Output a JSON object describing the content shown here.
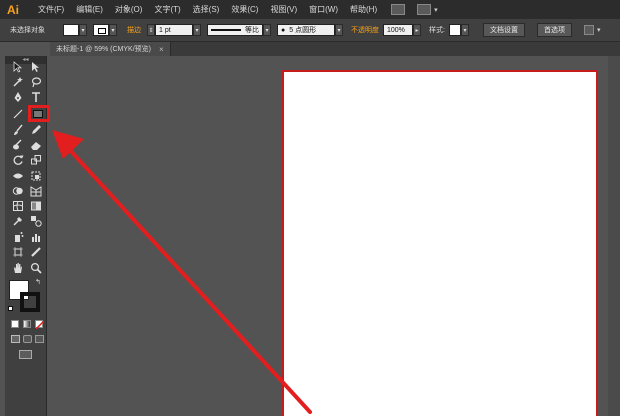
{
  "app": {
    "logo": "Ai"
  },
  "menubar": {
    "items": [
      "文件(F)",
      "编辑(E)",
      "对象(O)",
      "文字(T)",
      "选择(S)",
      "效果(C)",
      "视图(V)",
      "窗口(W)",
      "帮助(H)"
    ],
    "dd_glyph": "▾"
  },
  "controlbar": {
    "selection_label": "未选择对象",
    "stroke_label": "描边",
    "stroke_weight": "1 pt",
    "profile_label": "等比",
    "brush_label": "5 点圆形",
    "opacity_label": "不透明度",
    "opacity_value": "100%",
    "style_label": "样式:",
    "doc_setup": "文档设置",
    "preferences": "首选项"
  },
  "tabs": [
    {
      "label": "未标题-1 @ 59% (CMYK/预览)",
      "close": "×"
    }
  ],
  "toolbar": {
    "collapse": "◂◂",
    "swap_glyph": "↰"
  },
  "colors": {
    "accent_orange": "#f7a21c",
    "highlight_red": "#e31e1e",
    "artboard_border": "#c71c1c",
    "app_bg": "#535353",
    "menubar_bg": "#2c2c2c"
  }
}
